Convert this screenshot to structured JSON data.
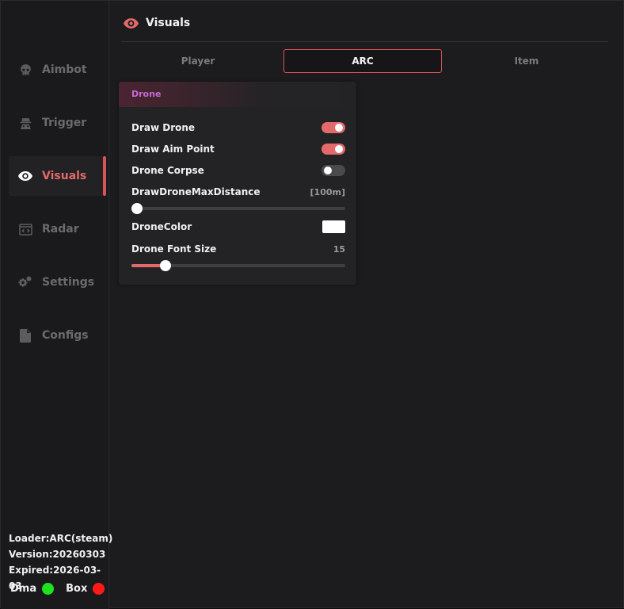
{
  "sidebar": {
    "items": [
      {
        "label": "Aimbot",
        "icon": "skull-icon"
      },
      {
        "label": "Trigger",
        "icon": "spy-icon"
      },
      {
        "label": "Visuals",
        "icon": "eye-icon",
        "active": true
      },
      {
        "label": "Radar",
        "icon": "code-window-icon"
      },
      {
        "label": "Settings",
        "icon": "gears-icon"
      },
      {
        "label": "Configs",
        "icon": "file-icon"
      }
    ],
    "footer": {
      "loader": "Loader:ARC(steam)",
      "version": "Version:20260303",
      "expired": "Expired:2026-03-03"
    },
    "status": {
      "dma_label": "Dma",
      "dma_color": "#1fe21f",
      "box_label": "Box",
      "box_color": "#ff1a1a"
    }
  },
  "header": {
    "title": "Visuals",
    "icon": "eye-icon"
  },
  "tabs": [
    {
      "label": "Player"
    },
    {
      "label": "ARC",
      "active": true
    },
    {
      "label": "Item"
    }
  ],
  "panel": {
    "title": "Drone",
    "draw_drone": {
      "label": "Draw Drone",
      "on": true
    },
    "draw_aim_point": {
      "label": "Draw Aim Point",
      "on": true
    },
    "drone_corpse": {
      "label": "Drone Corpse",
      "on": false
    },
    "max_distance": {
      "label": "DrawDroneMaxDistance",
      "value_text": "[100m]",
      "fraction": 0.0
    },
    "drone_color": {
      "label": "DroneColor",
      "color": "#ffffff"
    },
    "font_size": {
      "label": "Drone Font Size",
      "value_text": "15",
      "fraction": 0.16
    }
  },
  "colors": {
    "accent": "#e36a6a",
    "active_border": "#d9535a",
    "section_title": "#c56ad6"
  }
}
